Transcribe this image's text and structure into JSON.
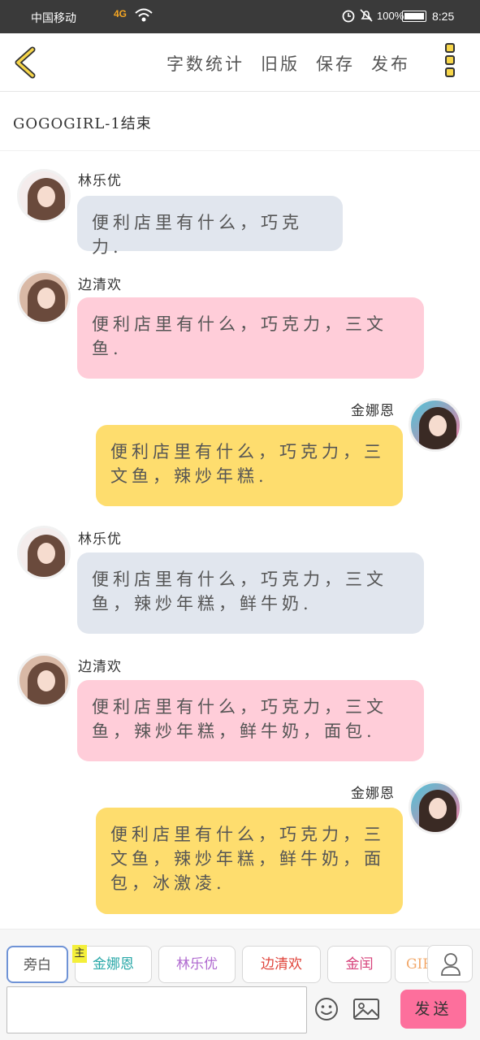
{
  "status_bar": {
    "carrier": "中国移动",
    "network": "4G",
    "battery": "100%",
    "time": "8:25"
  },
  "nav": {
    "actions": [
      "字数统计",
      "旧版",
      "保存",
      "发布"
    ]
  },
  "chapter_title": "GOGOGIRL-1结束",
  "messages": [
    {
      "sender": "林乐优",
      "text": "便利店里有什么，巧克力.",
      "side": "left",
      "color": "blue"
    },
    {
      "sender": "边清欢",
      "text": "便利店里有什么，巧克力，三文鱼.",
      "side": "left",
      "color": "pink"
    },
    {
      "sender": "金娜恩",
      "text": "便利店里有什么，巧克力，三文鱼，辣炒年糕.",
      "side": "right",
      "color": "yellow"
    },
    {
      "sender": "林乐优",
      "text": "便利店里有什么，巧克力，三文鱼，辣炒年糕，鲜牛奶.",
      "side": "left",
      "color": "blue"
    },
    {
      "sender": "边清欢",
      "text": "便利店里有什么，巧克力，三文鱼，辣炒年糕，鲜牛奶，面包.",
      "side": "left",
      "color": "pink"
    },
    {
      "sender": "金娜恩",
      "text": "便利店里有什么，巧克力，三文鱼，辣炒年糕，鲜牛奶，面包，冰激凌.",
      "side": "right",
      "color": "yellow"
    }
  ],
  "roles": [
    {
      "label": "旁白",
      "color": "#555555"
    },
    {
      "label": "金娜恩",
      "color": "#2aa8a8"
    },
    {
      "label": "林乐优",
      "color": "#b06ad0"
    },
    {
      "label": "边清欢",
      "color": "#e0453c"
    },
    {
      "label": "金闰",
      "color": "#d6407a"
    },
    {
      "label": "GIF",
      "color": "#f2a86a"
    }
  ],
  "main_badge": "主",
  "input": {
    "value": "",
    "placeholder": ""
  },
  "send_label": "发送",
  "icons": [
    "back-icon",
    "more-icon",
    "person-icon",
    "emoji-icon",
    "image-icon",
    "wifi-icon",
    "alarm-icon",
    "mute-icon",
    "battery-icon"
  ]
}
